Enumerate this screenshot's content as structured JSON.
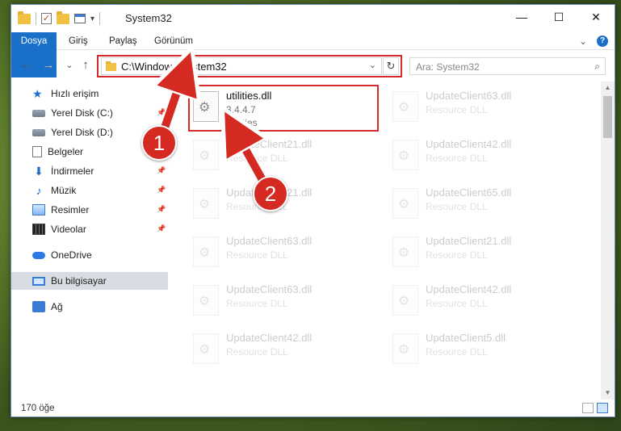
{
  "window": {
    "title": "System32",
    "minimize_icon": "—",
    "maximize_icon": "☐",
    "close_icon": "✕"
  },
  "ribbon": {
    "tabs": [
      "Dosya",
      "Giriş",
      "Paylaş",
      "Görünüm"
    ],
    "expand_icon": "⌄",
    "help_icon": "?"
  },
  "quick_access": {
    "dropdown": "▾"
  },
  "address": {
    "back": "←",
    "forward": "→",
    "recent": "⌄",
    "up": "↑",
    "path": "C:\\Windows\\System32",
    "dropdown": "⌄",
    "refresh": "↻",
    "search_placeholder": "Ara: System32",
    "search_icon": "⌕"
  },
  "sidebar": {
    "items": [
      {
        "label": "Hızlı erişim",
        "icon": "star-icon",
        "pinned": false
      },
      {
        "label": "Yerel Disk (C:)",
        "icon": "drive-icon",
        "pinned": true
      },
      {
        "label": "Yerel Disk (D:)",
        "icon": "drive-icon",
        "pinned": true
      },
      {
        "label": "Belgeler",
        "icon": "documents-icon",
        "pinned": true
      },
      {
        "label": "İndirmeler",
        "icon": "download-icon",
        "pinned": true
      },
      {
        "label": "Müzik",
        "icon": "music-icon",
        "pinned": true
      },
      {
        "label": "Resimler",
        "icon": "pictures-icon",
        "pinned": true
      },
      {
        "label": "Videolar",
        "icon": "videos-icon",
        "pinned": true
      },
      {
        "label": "OneDrive",
        "icon": "onedrive-icon",
        "pinned": false
      },
      {
        "label": "Bu bilgisayar",
        "icon": "this-pc-icon",
        "pinned": false,
        "selected": true
      },
      {
        "label": "Ağ",
        "icon": "network-icon",
        "pinned": false
      }
    ],
    "pin_glyph": "📌"
  },
  "files": [
    {
      "name": "utilities.dll",
      "version": "3.4.4.7",
      "type": "Utilities",
      "faded": false
    },
    {
      "name": "UpdateClient63.dll",
      "type": "Resource DLL",
      "faded": true
    },
    {
      "name": "UpdateClient21.dll",
      "type": "Resource DLL",
      "faded": true
    },
    {
      "name": "UpdateClient42.dll",
      "type": "Resource DLL",
      "faded": true
    },
    {
      "name": "UpdateClient21.dll",
      "type": "Resource DLL",
      "faded": true
    },
    {
      "name": "UpdateClient65.dll",
      "type": "Resource DLL",
      "faded": true
    },
    {
      "name": "UpdateClient63.dll",
      "type": "Resource DLL",
      "faded": true
    },
    {
      "name": "UpdateClient21.dll",
      "type": "Resource DLL",
      "faded": true
    },
    {
      "name": "UpdateClient63.dll",
      "type": "Resource DLL",
      "faded": true
    },
    {
      "name": "UpdateClient42.dll",
      "type": "Resource DLL",
      "faded": true
    },
    {
      "name": "UpdateClient42.dll",
      "type": "Resource DLL",
      "faded": true
    },
    {
      "name": "UpdateClient5.dll",
      "type": "Resource DLL",
      "faded": true
    }
  ],
  "status": {
    "item_count": "170 öğe"
  },
  "annotations": {
    "badge_1": "1",
    "badge_2": "2",
    "color": "#d42a22"
  }
}
